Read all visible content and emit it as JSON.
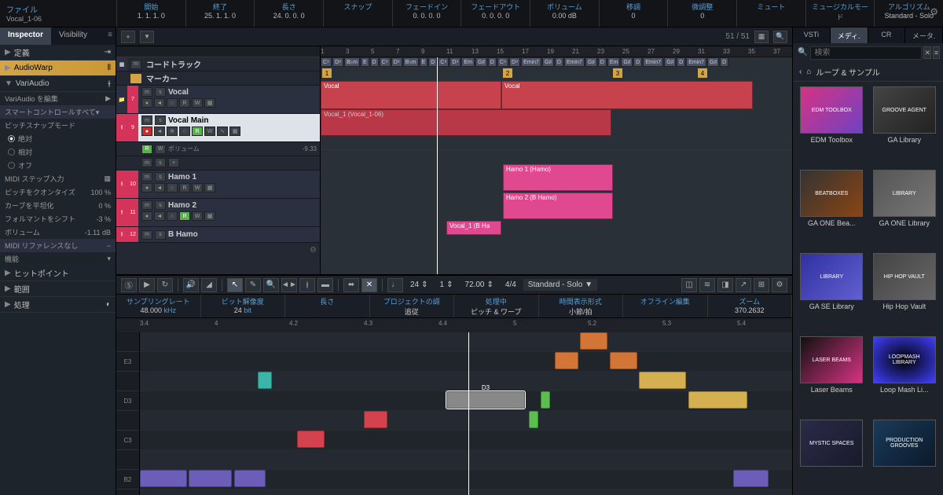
{
  "topbar": {
    "title_label": "ファイル",
    "title_value": "Vocal_1-06",
    "fields": [
      {
        "label": "開始",
        "value": "1. 1. 1. 0"
      },
      {
        "label": "終了",
        "value": "25. 1. 1. 0"
      },
      {
        "label": "長さ",
        "value": "24. 0. 0. 0"
      },
      {
        "label": "スナップ",
        "value": ""
      },
      {
        "label": "フェードイン",
        "value": "0. 0. 0. 0"
      },
      {
        "label": "フェードアウト",
        "value": "0. 0. 0. 0"
      },
      {
        "label": "ボリューム",
        "value": "0.00 dB"
      },
      {
        "label": "移調",
        "value": "0"
      },
      {
        "label": "微調整",
        "value": "0"
      },
      {
        "label": "ミュート",
        "value": ""
      },
      {
        "label": "ミュージカルモード",
        "value": ""
      },
      {
        "label": "アルゴリズム",
        "value": "Standard - Solo"
      }
    ]
  },
  "inspector": {
    "tabs": [
      "Inspector",
      "Visibility"
    ],
    "rows": {
      "def": "定義",
      "audiowarp": "AudioWarp",
      "variaudio": "VariAudio",
      "va_edit": "VariAudio を編集",
      "smart": "スマートコントロールすべて▾",
      "pitchsnap": "ピッチスナップモード",
      "opt_abs": "絶対",
      "opt_rel": "相対",
      "opt_off": "オフ",
      "midi_step": "MIDI ステップ入力",
      "quantize_l": "ピッチをクオンタイズ",
      "quantize_v": "100 %",
      "curve_l": "カーブを平坦化",
      "curve_v": "0 %",
      "formant_l": "フォルマントをシフト",
      "formant_v": "-3 %",
      "volume_l": "ボリューム",
      "volume_v": "-1.11 dB",
      "midi_ref": "MIDI リファレンスなし",
      "func": "機能",
      "hitpoint": "ヒットポイント",
      "range": "範囲",
      "process": "処理"
    }
  },
  "proj_header": {
    "count": "51 / 51"
  },
  "ruler_marks": [
    1,
    3,
    5,
    7,
    9,
    11,
    13,
    15,
    17,
    19,
    21,
    23,
    25,
    27,
    29,
    31,
    33,
    35,
    37
  ],
  "tracks": {
    "chord": "コードトラック",
    "marker": "マーカー",
    "vocal": "Vocal",
    "vocal_main": "Vocal Main",
    "volume": "ボリューム",
    "volume_val": "-9.33",
    "hamo1": "Hamo 1",
    "hamo2": "Hamo 2",
    "bhamo": "B Hamo"
  },
  "chords": [
    "C⁹",
    "D⁹",
    "B♭m",
    "E",
    "D",
    "C⁹",
    "D⁹",
    "B♭m",
    "E",
    "D",
    "C⁹",
    "D⁹",
    "Em",
    "G♯",
    "D",
    "C⁹",
    "D⁹",
    "Emin7",
    "G♯",
    "D",
    "Emin7",
    "G♯",
    "D",
    "Em",
    "G♯",
    "D",
    "Emin7",
    "G♯",
    "D",
    "Emin7",
    "G♯",
    "D"
  ],
  "markers": [
    "1",
    "2",
    "3",
    "4"
  ],
  "clips": {
    "vocal": "Vocal",
    "vocal1": "Vocal_1 (Vocal_1-06)",
    "hamo1": "Hamo 1 (Hamo)",
    "hamo2": "Hamo 2 (B Hamo)",
    "bhamo": "Vocal_1 (B Ha"
  },
  "editor": {
    "toolbar_vals": {
      "val1": "24",
      "val2": "1",
      "tempo": "72.00",
      "sig": "4/4",
      "algo": "Standard - Solo"
    },
    "info": [
      {
        "label": "サンプリングレート",
        "value": "48.000",
        "unit": "kHz"
      },
      {
        "label": "ビット解像度",
        "value": "24",
        "unit": "bit"
      },
      {
        "label": "長さ",
        "value": "",
        "unit": ""
      },
      {
        "label": "プロジェクトの調",
        "value": "追従",
        "unit": ""
      },
      {
        "label": "処理中",
        "value": "ピッチ & ワープ",
        "unit": ""
      },
      {
        "label": "時間表示形式",
        "value": "小節/拍",
        "unit": ""
      },
      {
        "label": "オフライン編集",
        "value": "",
        "unit": ""
      },
      {
        "label": "ズーム",
        "value": "370.2632",
        "unit": ""
      }
    ],
    "ed_ruler": [
      "3.4",
      "4",
      "4.2",
      "4.3",
      "4.4",
      "5",
      "5.2",
      "5.3",
      "5.4"
    ],
    "keys": [
      "E3",
      "D3",
      "C3",
      "B2"
    ],
    "sel_note": "D3"
  },
  "right": {
    "tabs": [
      "VSTi",
      "メディ.",
      "CR",
      "メータ."
    ],
    "search_ph": "検索",
    "bread": "ループ & サンプル",
    "items": [
      {
        "cls": "edm",
        "label": "EDM Toolbox",
        "thumb": "EDM TOOLBOX"
      },
      {
        "cls": "ga",
        "label": "GA Library",
        "thumb": "GROOVE AGENT"
      },
      {
        "cls": "beat",
        "label": "GA ONE Bea...",
        "thumb": "BEATBOXES"
      },
      {
        "cls": "lib",
        "label": "GA ONE Library",
        "thumb": "LIBRARY"
      },
      {
        "cls": "se",
        "label": "GA SE Library",
        "thumb": "LIBRARY"
      },
      {
        "cls": "hip",
        "label": "Hip Hop Vault",
        "thumb": "HIP HOP VAULT"
      },
      {
        "cls": "laser",
        "label": "Laser Beams",
        "thumb": "LASER BEAMS"
      },
      {
        "cls": "loop",
        "label": "Loop Mash Li...",
        "thumb": "LOOPMASH LIBRARY"
      },
      {
        "cls": "mystic",
        "label": "",
        "thumb": "MYSTIC SPACES"
      },
      {
        "cls": "prod",
        "label": "",
        "thumb": "PRODUCTION GROOVES"
      }
    ]
  }
}
